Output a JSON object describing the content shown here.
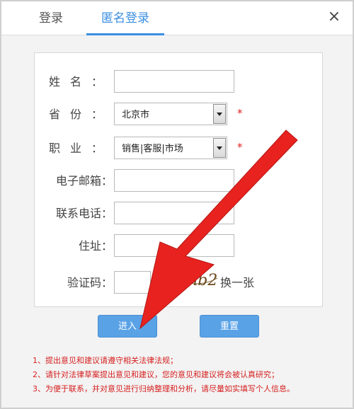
{
  "tabs": {
    "login": "登录",
    "anonymous": "匿名登录"
  },
  "close_icon": "×",
  "form": {
    "name_label": "姓名：",
    "province_label": "省份：",
    "province_value": "北京市",
    "job_label": "职业：",
    "job_value": "销售|客服|市场",
    "email_label": "电子邮箱：",
    "phone_label": "联系电话：",
    "address_label": "住址：",
    "captcha_label": "验证码：",
    "captcha_text": "8gnb2",
    "refresh_label": "换一张",
    "required_mark": "*"
  },
  "buttons": {
    "enter": "进入",
    "reset": "重置"
  },
  "notes": [
    "1、提出意见和建议请遵守相关法律法规；",
    "2、请针对法律草案提出意见和建议，您的意见和建议将会被认真研究；",
    "3、为便于联系，并对意见进行归纳整理和分析，请尽量如实填写个人信息。"
  ],
  "colors": {
    "accent": "#3b8fe0",
    "button": "#5aa2e6",
    "required": "#e02020",
    "arrow": "#e8231f"
  }
}
